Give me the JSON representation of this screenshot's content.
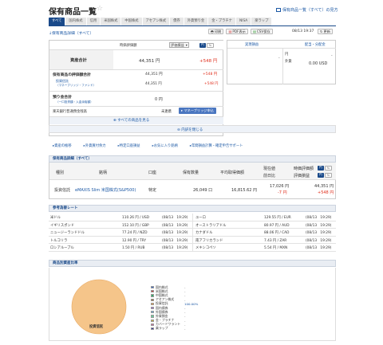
{
  "header": {
    "title": "保有商品一覧",
    "top_link": "保有商品一覧（すべて）の見方"
  },
  "tabs": [
    "すべて",
    "国内株式",
    "信用",
    "米国株式",
    "中国株式",
    "アセアン株式",
    "債券",
    "外貨預り金",
    "金・プラチナ",
    "NISA",
    "楽ラップ"
  ],
  "toolbar": {
    "detail_link": "保有商品詳細（すべて）",
    "print_label": "印刷",
    "pdf_label": "PDF表示",
    "csv_label": "CSV保存",
    "datetime": "08/13 19:37",
    "refresh_label": "更新"
  },
  "summary": {
    "col_market_value": "時価評価額",
    "eval_select": "評価損益",
    "yen_toggle": "円",
    "pct_toggle": "%",
    "asset_total_label": "資産合計",
    "asset_total_value": "44,351 円",
    "asset_total_pl": "+548 円",
    "holdings_total_label": "保有商品の評価額合計",
    "holdings_total_value": "44,351 円",
    "holdings_total_pl": "+548 円",
    "fund_label": "投資信託",
    "fund_sub": "（マネーブリッジ・ファンド）",
    "fund_value": "44,351 円",
    "fund_pl": "+548 円",
    "deposit_label": "預り金合計",
    "deposit_sub": "（一口投資額・入金余裕額）",
    "deposit_value": "0 円",
    "bank_label": "楽天銀行普通預金残高",
    "bank_status": "未連携",
    "money_bridge_label": "マネーブリッジ申込",
    "show_all": "すべての商品を見る",
    "details_link": "内訳を閉じる",
    "actual_label": "実現損益",
    "dividend_label": "配当・分配金",
    "actual_value": "-",
    "yen_unit": "円",
    "yen_cash_value": "-",
    "foreign_label": "外貨",
    "foreign_value": "0.00 USD"
  },
  "navlinks": [
    "資産の推移",
    "外貨買付余力",
    "特定口座損益",
    "お気に入り銘柄",
    "年間損益計算・確定申告サポート"
  ],
  "holdings": {
    "section_title": "保有商品詳細（すべて）",
    "headers": {
      "type": "種別",
      "name": "銘柄",
      "account": "口座",
      "quantity": "保有数量",
      "avg_price": "平均取得価額",
      "current_price": "現在値",
      "prev_diff": "前日比",
      "market_value": "時価評価額",
      "eval_pl": "評価損益",
      "yen": "円",
      "pct": "%"
    },
    "rows": [
      {
        "type": "投資信託",
        "name": "eMAXIS Slim 米国株式(S&P500)",
        "account": "特定",
        "quantity": "26,049 口",
        "avg_price": "16,815.62 円",
        "current_price": "17,026 円",
        "prev_diff": "-7 円",
        "market_value": "44,351 円",
        "eval_pl": "+548 円"
      }
    ]
  },
  "fx": {
    "section_title": "参考為替レート",
    "rows": [
      {
        "left_name": "米ドル",
        "left_rate": "110.26 円 / USD",
        "left_time": "(08/13　19:29)",
        "right_name": "ユーロ",
        "right_rate": "129.55 円 / EUR",
        "right_time": "(08/13　19:29)"
      },
      {
        "left_name": "イギリスポンド",
        "left_rate": "152.10 円 / GBP",
        "left_time": "(08/13　19:29)",
        "right_name": "オーストラリアドル",
        "right_rate": "80.97 円 / AUD",
        "right_time": "(08/13　19:29)"
      },
      {
        "left_name": "ニュージーランドドル",
        "left_rate": "77.24 円 / NZD",
        "left_time": "(08/13　19:29)",
        "right_name": "カナダドル",
        "right_rate": "88.06 円 / CAD",
        "right_time": "(08/13　19:29)"
      },
      {
        "left_name": "トルコリラ",
        "left_rate": "12.90 円 / TRY",
        "left_time": "(08/13　19:29)",
        "right_name": "南アフリカランド",
        "right_rate": "7.43 円 / ZAR",
        "right_time": "(08/13　19:29)"
      },
      {
        "left_name": "ロシアルーブル",
        "left_rate": "1.50 円 / RUB",
        "left_time": "(08/13　19:29)",
        "right_name": "メキシコペソ",
        "right_rate": "5.54 円 / MXN",
        "right_time": "(08/13　19:29)"
      }
    ]
  },
  "ratio": {
    "section_title": "商品別資産比率",
    "pie_label": "投資信託",
    "legend": [
      {
        "name": "国内株式",
        "value": "-",
        "color": "#3366cc"
      },
      {
        "name": "米国株式",
        "value": "-",
        "color": "#cc3333"
      },
      {
        "name": "中国株式",
        "value": "-",
        "color": "#33aa66"
      },
      {
        "name": "アセアン株式",
        "value": "-",
        "color": "#996633"
      },
      {
        "name": "投資信託",
        "value": "100.00%",
        "color": "#f0a040"
      },
      {
        "name": "国内債券",
        "value": "-",
        "color": "#9966cc"
      },
      {
        "name": "外国債券",
        "value": "-",
        "color": "#66aadd"
      },
      {
        "name": "外貨預金",
        "value": "-",
        "color": "#66cc99"
      },
      {
        "name": "金・プラチナ",
        "value": "-",
        "color": "#ccaa33"
      },
      {
        "name": "カバードワラント",
        "value": "-",
        "color": "#cc6699"
      },
      {
        "name": "楽ラップ",
        "value": "-",
        "color": "#333399"
      }
    ],
    "chart_data": {
      "type": "pie",
      "categories": [
        "投資信託"
      ],
      "values": [
        100.0
      ]
    }
  }
}
